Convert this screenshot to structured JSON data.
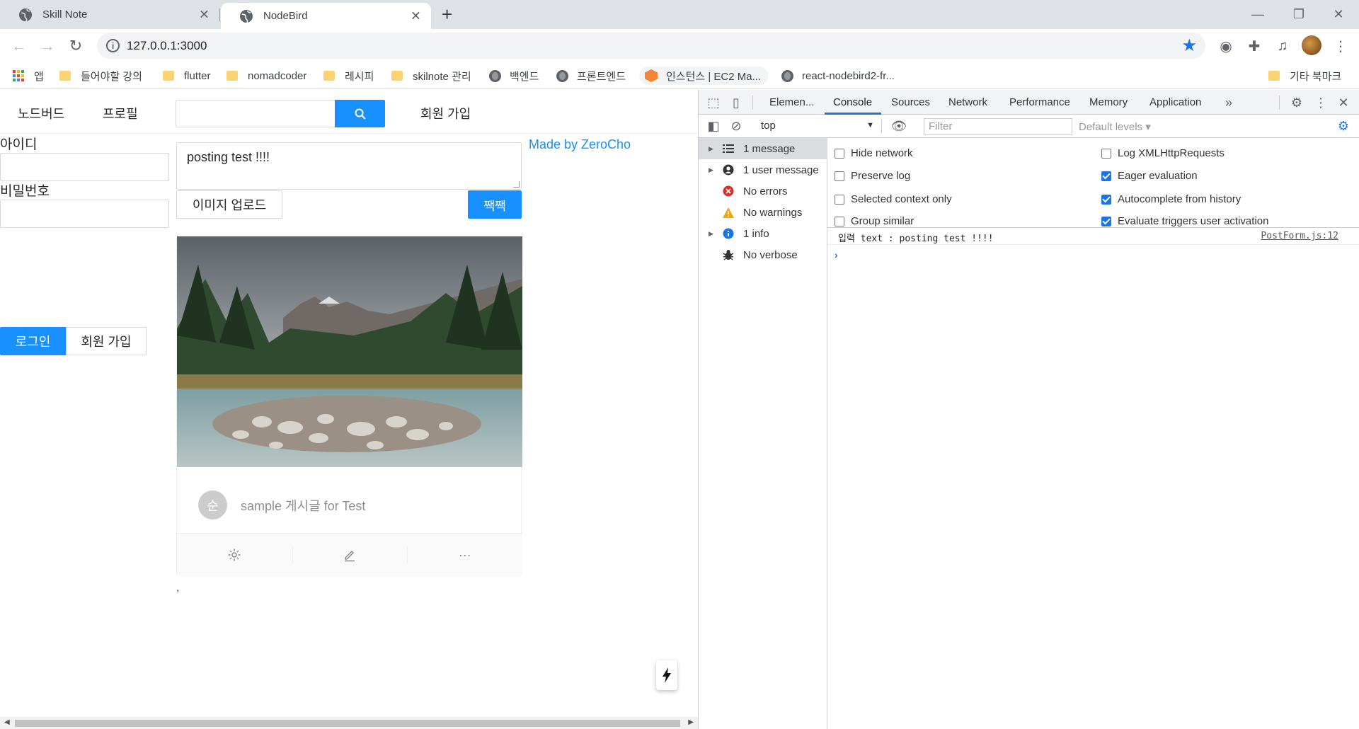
{
  "browser": {
    "tabs": [
      {
        "title": "Skill Note",
        "active": false
      },
      {
        "title": "NodeBird",
        "active": true
      }
    ],
    "url": "127.0.0.1:3000",
    "bookmarks": {
      "apps": "앱",
      "items": [
        {
          "label": "들어야할 강의",
          "icon": "folder-icon"
        },
        {
          "label": "flutter",
          "icon": "folder-icon"
        },
        {
          "label": "nomadcoder",
          "icon": "folder-icon"
        },
        {
          "label": "레시피",
          "icon": "folder-icon"
        },
        {
          "label": "skilnote 관리",
          "icon": "folder-icon"
        },
        {
          "label": "백엔드",
          "icon": "globe-icon"
        },
        {
          "label": "프론트엔드",
          "icon": "globe-icon"
        },
        {
          "label": "인스턴스 | EC2 Ma...",
          "icon": "aws-icon"
        },
        {
          "label": "react-nodebird2-fr...",
          "icon": "globe-icon"
        }
      ],
      "other": "기타 북마크"
    }
  },
  "app": {
    "menu": {
      "home": "노드버드",
      "profile": "프로필",
      "signup": "회원 가입"
    },
    "login": {
      "id_label": "아이디",
      "pw_label": "비밀번호",
      "login_button": "로그인",
      "signup_button": "회원 가입"
    },
    "post_form": {
      "text": "posting test !!!!",
      "upload_button": "이미지 업로드",
      "submit_button": "짹짹"
    },
    "made_by": "Made by ZeroCho",
    "post": {
      "avatar_letter": "순",
      "description": "sample 게시글 for Test"
    },
    "trailing": ","
  },
  "devtools": {
    "tabs": [
      "Elemen...",
      "Console",
      "Sources",
      "Network",
      "Performance",
      "Memory",
      "Application"
    ],
    "active_tab": "Console",
    "context": "top",
    "filter_placeholder": "Filter",
    "levels": "Default levels",
    "sidebar": [
      {
        "label": "1 message",
        "icon": "list-icon",
        "expandable": true,
        "selected": true
      },
      {
        "label": "1 user message",
        "icon": "user-icon",
        "expandable": true,
        "selected": false
      },
      {
        "label": "No errors",
        "icon": "error-icon",
        "expandable": false,
        "selected": false
      },
      {
        "label": "No warnings",
        "icon": "warning-icon",
        "expandable": false,
        "selected": false
      },
      {
        "label": "1 info",
        "icon": "info-icon",
        "expandable": true,
        "selected": false
      },
      {
        "label": "No verbose",
        "icon": "bug-icon",
        "expandable": false,
        "selected": false
      }
    ],
    "settings": {
      "hide_network": {
        "label": "Hide network",
        "checked": false
      },
      "preserve_log": {
        "label": "Preserve log",
        "checked": false
      },
      "selected_context": {
        "label": "Selected context only",
        "checked": false
      },
      "group_similar": {
        "label": "Group similar",
        "checked": false
      },
      "log_xhr": {
        "label": "Log XMLHttpRequests",
        "checked": false
      },
      "eager_eval": {
        "label": "Eager evaluation",
        "checked": true
      },
      "autocomplete": {
        "label": "Autocomplete from history",
        "checked": true
      },
      "evaluate_triggers": {
        "label": "Evaluate triggers user activation",
        "checked": true
      }
    },
    "console": {
      "message": "입력 text : posting test !!!!",
      "source": "PostForm.js:12"
    }
  },
  "colors": {
    "primary": "#1890ff",
    "devtools_accent": "#1a73e8"
  }
}
